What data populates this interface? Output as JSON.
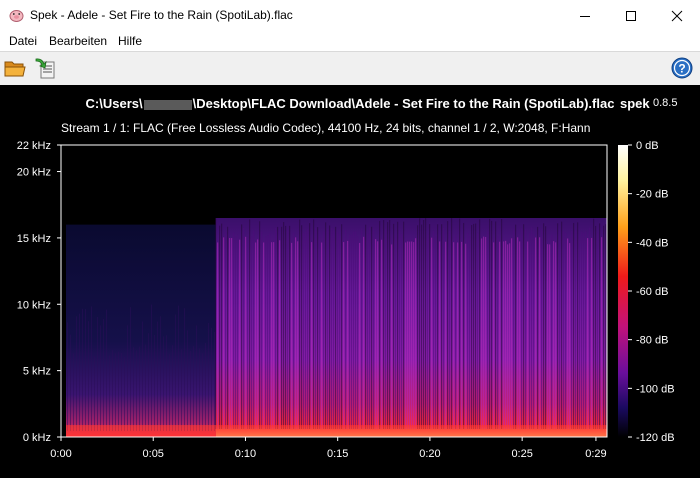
{
  "window": {
    "title": "Spek - Adele - Set Fire to the Rain (SpotiLab).flac",
    "app_icon": "spek-pig-icon"
  },
  "menu": {
    "items": [
      "Datei",
      "Bearbeiten",
      "Hilfe"
    ]
  },
  "toolbar": {
    "open_icon": "folder-open-icon",
    "save_icon": "save-export-icon",
    "help_icon": "help-icon"
  },
  "spectrogram": {
    "path_prefix": "C:\\Users\\",
    "path_suffix": "\\Desktop\\FLAC Download\\Adele - Set Fire to the Rain (SpotiLab).flac",
    "app_name": "spek",
    "app_version": "0.8.5",
    "stream_info": "Stream 1 / 1: FLAC (Free Lossless Audio Codec), 44100 Hz, 24 bits, channel 1 / 2, W:2048, F:Hann",
    "freq_ticks": [
      "22 kHz",
      "20 kHz",
      "15 kHz",
      "10 kHz",
      "5 kHz",
      "0 kHz"
    ],
    "freq_values_khz": [
      22,
      20,
      15,
      10,
      5,
      0
    ],
    "time_ticks": [
      "0:00",
      "0:05",
      "0:10",
      "0:15",
      "0:20",
      "0:25",
      "0:29"
    ],
    "time_values_s": [
      0,
      5,
      10,
      15,
      20,
      25,
      29
    ],
    "db_ticks": [
      "0 dB",
      "-20 dB",
      "-40 dB",
      "-60 dB",
      "-80 dB",
      "-100 dB",
      "-120 dB"
    ],
    "db_values": [
      0,
      -20,
      -40,
      -60,
      -80,
      -100,
      -120
    ],
    "duration_s": 29.6,
    "cutoff_khz_intro": 16,
    "cutoff_khz_main": 16.5,
    "intro_end_s": 8.4
  },
  "colors": {
    "background": "#000000",
    "low": "#0a0620",
    "mid": "#7a1aa8",
    "high": "#ff1e3c",
    "peak": "#fff3c0"
  }
}
